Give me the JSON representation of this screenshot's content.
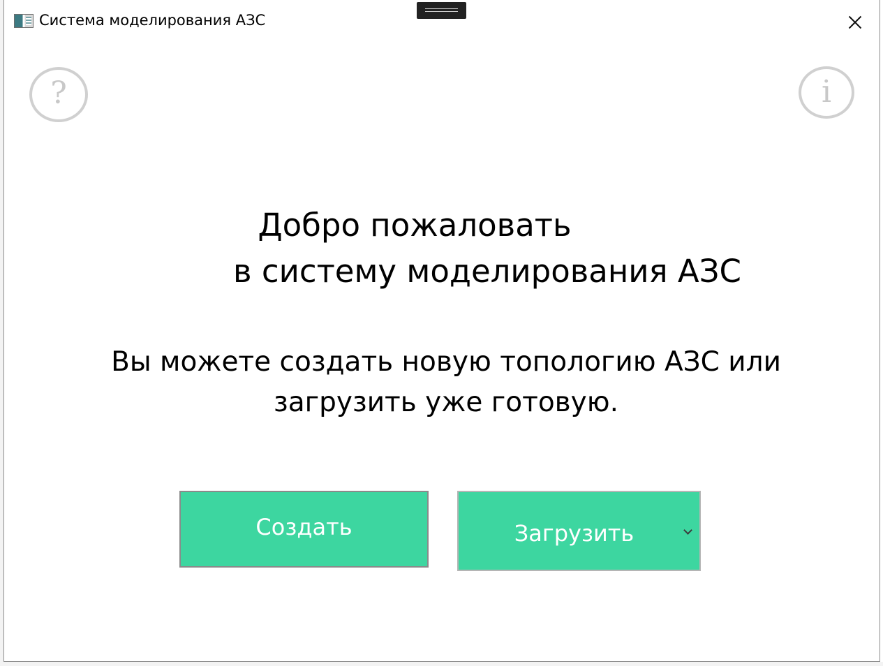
{
  "window": {
    "title": "Система моделирования АЗС"
  },
  "icons": {
    "app": "app-icon",
    "help": "help-icon",
    "info": "info-icon",
    "close": "close-icon",
    "chevron": "chevron-down-icon"
  },
  "help_button": {
    "glyph": "?"
  },
  "info_button": {
    "glyph": "i"
  },
  "welcome": {
    "line1": "Добро пожаловать",
    "line2": "в систему моделирования АЗС"
  },
  "subtitle": {
    "line1": "Вы можете создать новую топологию АЗС или",
    "line2": "загрузить уже готовую."
  },
  "buttons": {
    "create": "Создать",
    "load": "Загрузить"
  },
  "colors": {
    "accent": "#3dd6a0",
    "icon_gray": "#d0d0d0"
  }
}
